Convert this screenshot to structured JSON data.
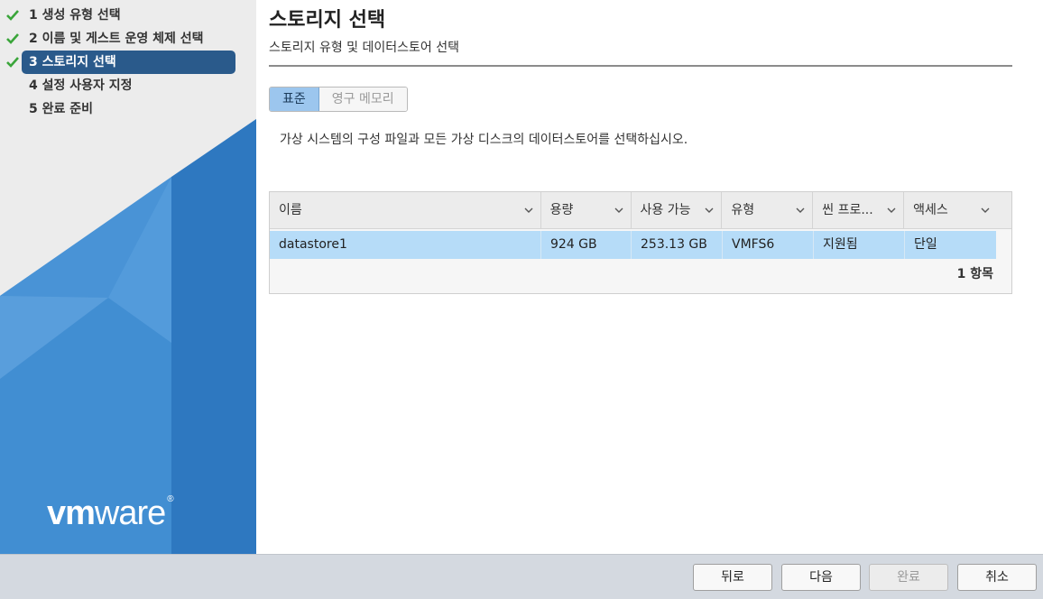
{
  "steps": [
    {
      "label": "1 생성 유형 선택",
      "done": true
    },
    {
      "label": "2 이름 및 게스트 운영 체제 선택",
      "done": true
    },
    {
      "label": "3 스토리지 선택",
      "done": true,
      "active": true
    },
    {
      "label": "4 설정 사용자 지정",
      "done": false
    },
    {
      "label": "5 완료 준비",
      "done": false
    }
  ],
  "logo": {
    "vm": "vm",
    "ware": "ware",
    "reg": "®"
  },
  "page": {
    "title": "스토리지 선택",
    "subtitle": "스토리지 유형 및 데이터스토어 선택",
    "description": "가상 시스템의 구성 파일과 모든 가상 디스크의 데이터스토어를 선택하십시오."
  },
  "storage_type": {
    "options": [
      "표준",
      "영구 메모리"
    ],
    "selected": "표준"
  },
  "table": {
    "columns": [
      "이름",
      "용량",
      "사용 가능",
      "유형",
      "씬 프로...",
      "액세스"
    ],
    "rows": [
      [
        "datastore1",
        "924 GB",
        "253.13 GB",
        "VMFS6",
        "지원됨",
        "단일"
      ]
    ],
    "count_label": "1 항목"
  },
  "buttons": {
    "back": "뒤로",
    "next": "다음",
    "finish": "완료",
    "cancel": "취소"
  },
  "colors": {
    "active_step": "#2a5a8b",
    "check": "#3aa53a",
    "selected_row": "#b6dcf8",
    "brand_blue": "#1e6fbf"
  }
}
